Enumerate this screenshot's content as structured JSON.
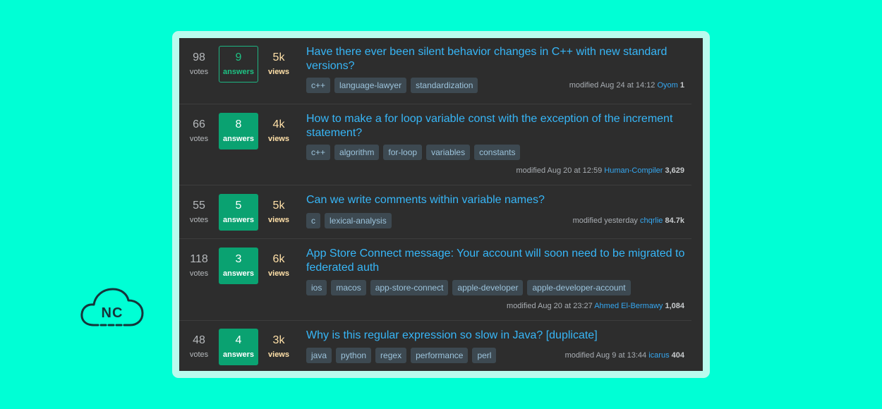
{
  "questions": [
    {
      "votes": "98",
      "votes_label": "votes",
      "answers": "9",
      "answers_label": "answers",
      "views": "5k",
      "views_label": "views",
      "title_line1": "Have there ever been silent behavior changes in C++ with new standard",
      "title_line2": "versions?",
      "tags": [
        "c++",
        "language-lawyer",
        "standardization"
      ],
      "modified": "modified Aug 24 at 14:12",
      "user": "Oyom",
      "rep": "1"
    },
    {
      "votes": "66",
      "votes_label": "votes",
      "answers": "8",
      "answers_label": "answers",
      "views": "4k",
      "views_label": "views",
      "title_line1": "How to make a for loop variable const with the exception of the increment",
      "title_line2": "statement?",
      "tags": [
        "c++",
        "algorithm",
        "for-loop",
        "variables",
        "constants"
      ],
      "modified": "modified Aug 20 at 12:59",
      "user": "Human-Compiler",
      "rep": "3,629"
    },
    {
      "votes": "55",
      "votes_label": "votes",
      "answers": "5",
      "answers_label": "answers",
      "views": "5k",
      "views_label": "views",
      "title_line1": "Can we write comments within variable names?",
      "tags": [
        "c",
        "lexical-analysis"
      ],
      "modified": "modified yesterday",
      "user": "chqrlie",
      "rep": "84.7k"
    },
    {
      "votes": "118",
      "votes_label": "votes",
      "answers": "3",
      "answers_label": "answers",
      "views": "6k",
      "views_label": "views",
      "title_line1": "App Store Connect message: Your account will soon need to be migrated to",
      "title_line2": "federated auth",
      "tags": [
        "ios",
        "macos",
        "app-store-connect",
        "apple-developer",
        "apple-developer-account"
      ],
      "modified": "modified Aug 20 at 23:27",
      "user": "Ahmed El-Bermawy",
      "rep": "1,084"
    },
    {
      "votes": "48",
      "votes_label": "votes",
      "answers": "4",
      "answers_label": "answers",
      "views": "3k",
      "views_label": "views",
      "title_line1": "Why is this regular expression so slow in Java? [duplicate]",
      "tags": [
        "java",
        "python",
        "regex",
        "performance",
        "perl"
      ],
      "modified": "modified Aug 9 at 13:44",
      "user": "icarus",
      "rep": "404"
    }
  ],
  "logo": {
    "text": "NC",
    "icon": "cloud-icon",
    "color": "#16343a"
  },
  "colors": {
    "background": "#00ffd5",
    "panel": "#2d2d2d",
    "link": "#37b6f7",
    "accepted": "#0aa271",
    "views": "#ffe0a8",
    "tag_bg": "#3d4951",
    "tag_text": "#9cc3db"
  }
}
